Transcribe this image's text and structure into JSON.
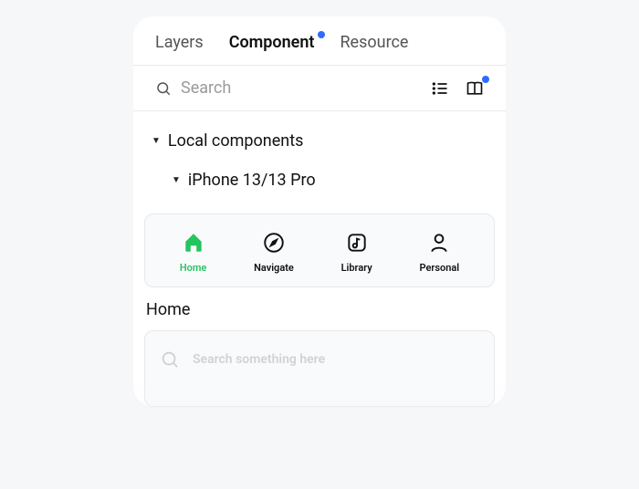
{
  "tabs": {
    "layers": "Layers",
    "component": "Component",
    "resource": "Resource"
  },
  "search": {
    "placeholder": "Search"
  },
  "tree": {
    "root": "Local components",
    "child": "iPhone 13/13 Pro"
  },
  "nav": {
    "home": "Home",
    "navigate": "Navigate",
    "library": "Library",
    "personal": "Personal"
  },
  "section": {
    "title": "Home"
  },
  "inner_search": {
    "placeholder": "Search something here"
  }
}
